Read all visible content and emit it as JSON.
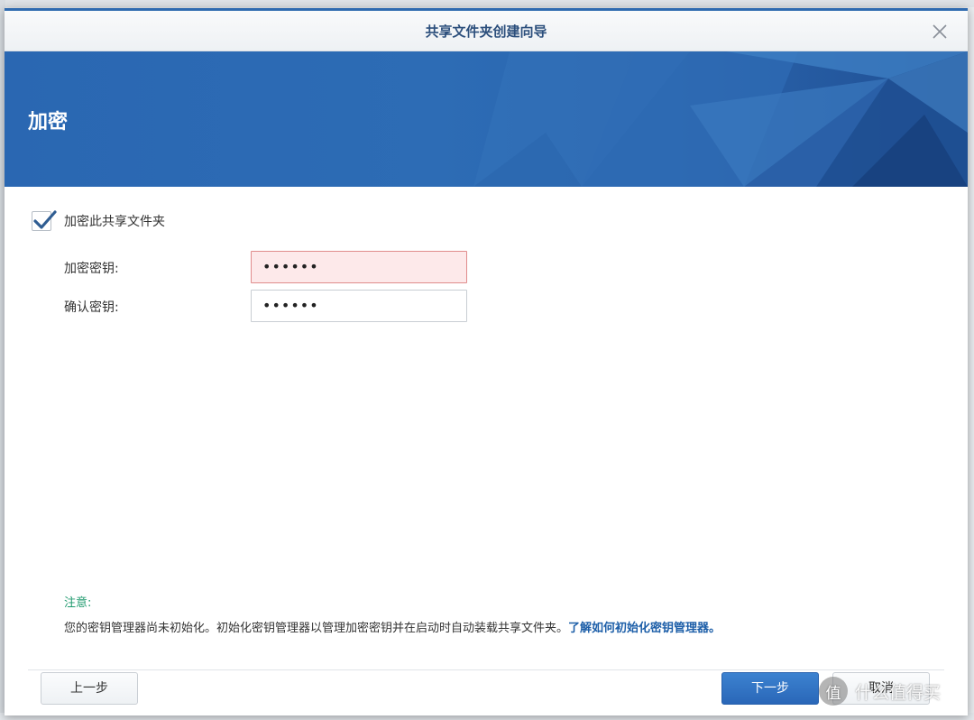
{
  "window": {
    "title": "共享文件夹创建向导"
  },
  "banner": {
    "heading": "加密"
  },
  "encrypt_checkbox": {
    "label": "加密此共享文件夹",
    "checked": true
  },
  "fields": {
    "key_label": "加密密钥:",
    "key_value": "••••••",
    "confirm_label": "确认密钥:",
    "confirm_value": "••••••"
  },
  "note": {
    "title": "注意:",
    "text": "您的密钥管理器尚未初始化。初始化密钥管理器以管理加密密钥并在启动时自动装载共享文件夹。",
    "link": "了解如何初始化密钥管理器。"
  },
  "buttons": {
    "prev": "上一步",
    "next": "下一步",
    "cancel": "取消"
  },
  "watermark": {
    "icon_text": "值",
    "text": "什么值得买"
  },
  "colors": {
    "accent": "#2f6bb0",
    "banner": "#2a67b2",
    "note_title": "#1f9a6e",
    "link": "#1c5ea8",
    "error_field": "#fde9ea"
  }
}
